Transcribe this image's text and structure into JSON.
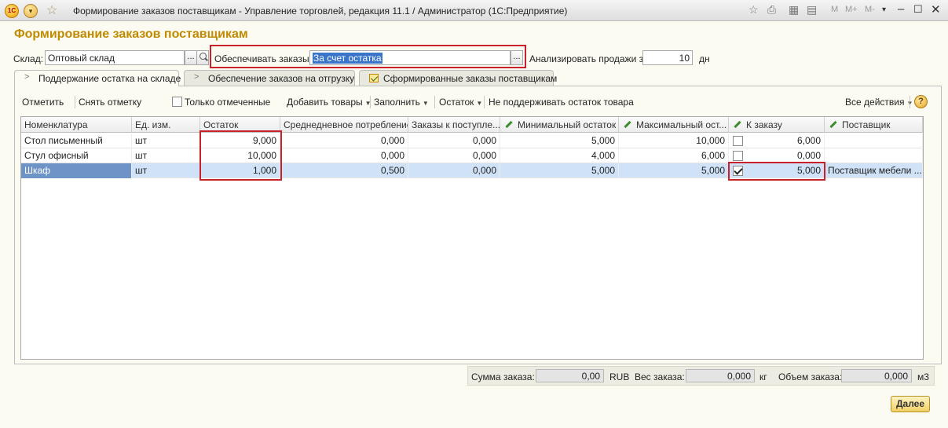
{
  "window": {
    "title": "Формирование заказов поставщикам - Управление торговлей, редакция 11.1 / Администратор  (1С:Предприятие)",
    "logo_text": "1С",
    "memory_buttons": [
      "M",
      "M+",
      "M-"
    ]
  },
  "header": {
    "title": "Формирование заказов поставщикам"
  },
  "filters": {
    "warehouse_label": "Склад:",
    "warehouse_value": "Оптовый склад",
    "fulfill_label": "Обеспечивать заказы:",
    "fulfill_value": "За счет остатка",
    "analyze_label": "Анализировать продажи за:",
    "analyze_value": "10",
    "analyze_unit": "дн",
    "dots": "..."
  },
  "tabs": [
    {
      "label": "Поддержание остатка на складе",
      "active": true
    },
    {
      "label": "Обеспечение заказов на отгрузку",
      "active": false
    },
    {
      "label": "Сформированные заказы поставщикам",
      "active": false
    }
  ],
  "toolbar": {
    "mark": "Отметить",
    "unmark": "Снять отметку",
    "only_marked": "Только отмеченные",
    "add_goods": "Добавить товары",
    "fill": "Заполнить",
    "remainder": "Остаток",
    "no_maintain": "Не поддерживать остаток товара",
    "all_actions": "Все действия",
    "help": "?"
  },
  "table": {
    "columns": [
      "Номенклатура",
      "Ед. изм.",
      "Остаток",
      "Среднедневное потребление",
      "Заказы к поступле...",
      "Минимальный остаток",
      "Максимальный ост...",
      "К заказу",
      "Поставщик"
    ],
    "rows": [
      {
        "name": "Стол письменный",
        "unit": "шт",
        "stock": "9,000",
        "avg": "0,000",
        "orders": "0,000",
        "min": "5,000",
        "max": "10,000",
        "checked": false,
        "order_qty": "6,000",
        "supplier": ""
      },
      {
        "name": "Стул офисный",
        "unit": "шт",
        "stock": "10,000",
        "avg": "0,000",
        "orders": "0,000",
        "min": "4,000",
        "max": "6,000",
        "checked": false,
        "order_qty": "0,000",
        "supplier": ""
      },
      {
        "name": "Шкаф",
        "unit": "шт",
        "stock": "1,000",
        "avg": "0,500",
        "orders": "0,000",
        "min": "5,000",
        "max": "5,000",
        "checked": true,
        "order_qty": "5,000",
        "supplier": "Поставщик мебели ..."
      }
    ]
  },
  "footer": {
    "sum_label": "Сумма заказа:",
    "sum_value": "0,00",
    "currency": "RUB",
    "weight_label": "Вес заказа:",
    "weight_value": "0,000",
    "weight_unit": "кг",
    "volume_label": "Объем заказа:",
    "volume_value": "0,000",
    "volume_unit": "м3",
    "next_button": "Далее"
  },
  "colors": {
    "accent": "#c08a00",
    "highlight": "#c8212a",
    "selection": "#cfe2f7"
  }
}
